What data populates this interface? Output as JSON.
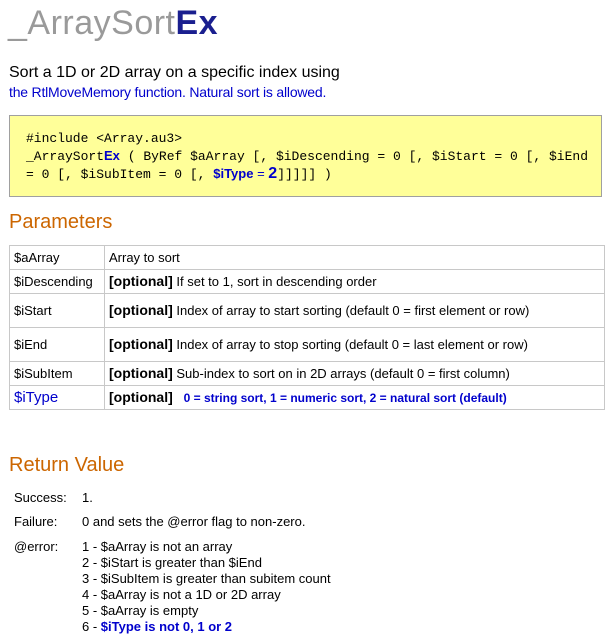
{
  "title": {
    "prefix": "_ArraySort",
    "suffix": "Ex"
  },
  "description": {
    "line1": "Sort a 1D or 2D array on a specific index using",
    "line2": "the RtlMoveMemory function. Natural sort is allowed."
  },
  "syntax": {
    "include": "#include <Array.au3>",
    "func_prefix": "_ArraySort",
    "func_suffix": "Ex",
    "line2_rest": " ( ByRef $aArray [, $iDescending = 0 [, $iStart = 0 [, $iEnd",
    "line3_a": "= 0 [, $iSubItem = 0 [, ",
    "line3_itype": "$iType",
    "line3_eq": " = ",
    "line3_val": "2",
    "line3_end": "]]]]] )"
  },
  "parameters": {
    "heading": "Parameters",
    "rows": [
      {
        "name": "$aArray",
        "optional": "",
        "desc": "Array to sort"
      },
      {
        "name": "$iDescending",
        "optional": "[optional]",
        "desc": " If set to 1, sort in descending order"
      },
      {
        "name": "$iStart",
        "optional": "[optional]",
        "desc": " Index of array to start sorting (default 0 = first element or row)"
      },
      {
        "name": "$iEnd",
        "optional": "[optional]",
        "desc": " Index of array to stop sorting (default 0 = last element or row)"
      },
      {
        "name": "$iSubItem",
        "optional": "[optional]",
        "desc": " Sub-index to sort on in 2D arrays (default 0 = first column)"
      },
      {
        "name": "$iType",
        "optional": "[optional]",
        "desc": "0 = string sort, 1 = numeric sort, 2 = natural sort (default)"
      }
    ]
  },
  "return_value": {
    "heading": "Return Value",
    "success_label": "Success:",
    "success_value": "1.",
    "failure_label": "Failure:",
    "failure_value": "0 and sets the @error flag to non-zero.",
    "error_label": "@error:",
    "errors": [
      "1 - $aArray is not an array",
      "2 - $iStart is greater than $iEnd",
      "3 - $iSubItem is greater than subitem count",
      "4 - $aArray is not a 1D or 2D array",
      "5 - $aArray is empty"
    ],
    "error6_prefix": "6 - ",
    "error6_text": "$iType is not 0, 1 or 2"
  }
}
